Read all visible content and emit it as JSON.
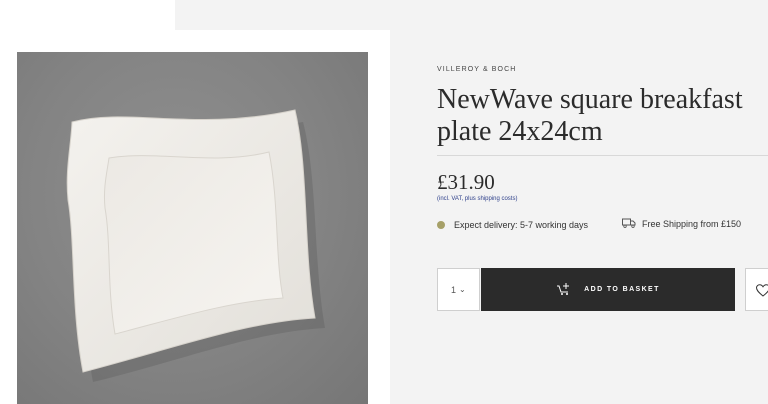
{
  "product": {
    "image_alt": "NewWave square breakfast plate",
    "brand": "VILLEROY & BOCH",
    "title": "NewWave square breakfast plate 24x24cm",
    "price": "£31.90",
    "vat_note": "(incl. VAT, plus shipping costs)"
  },
  "delivery": {
    "text": "Expect delivery: 5-7 working days",
    "status_color": "#a6a068",
    "icon": "status-dot"
  },
  "shipping": {
    "text": "Free Shipping from £150",
    "icon": "truck-icon"
  },
  "purchase": {
    "quantity": "1",
    "add_label": "ADD TO BASKET",
    "add_icon": "cart-add-icon",
    "wishlist_icon": "heart-icon",
    "button_color": "#2b2b2b"
  }
}
